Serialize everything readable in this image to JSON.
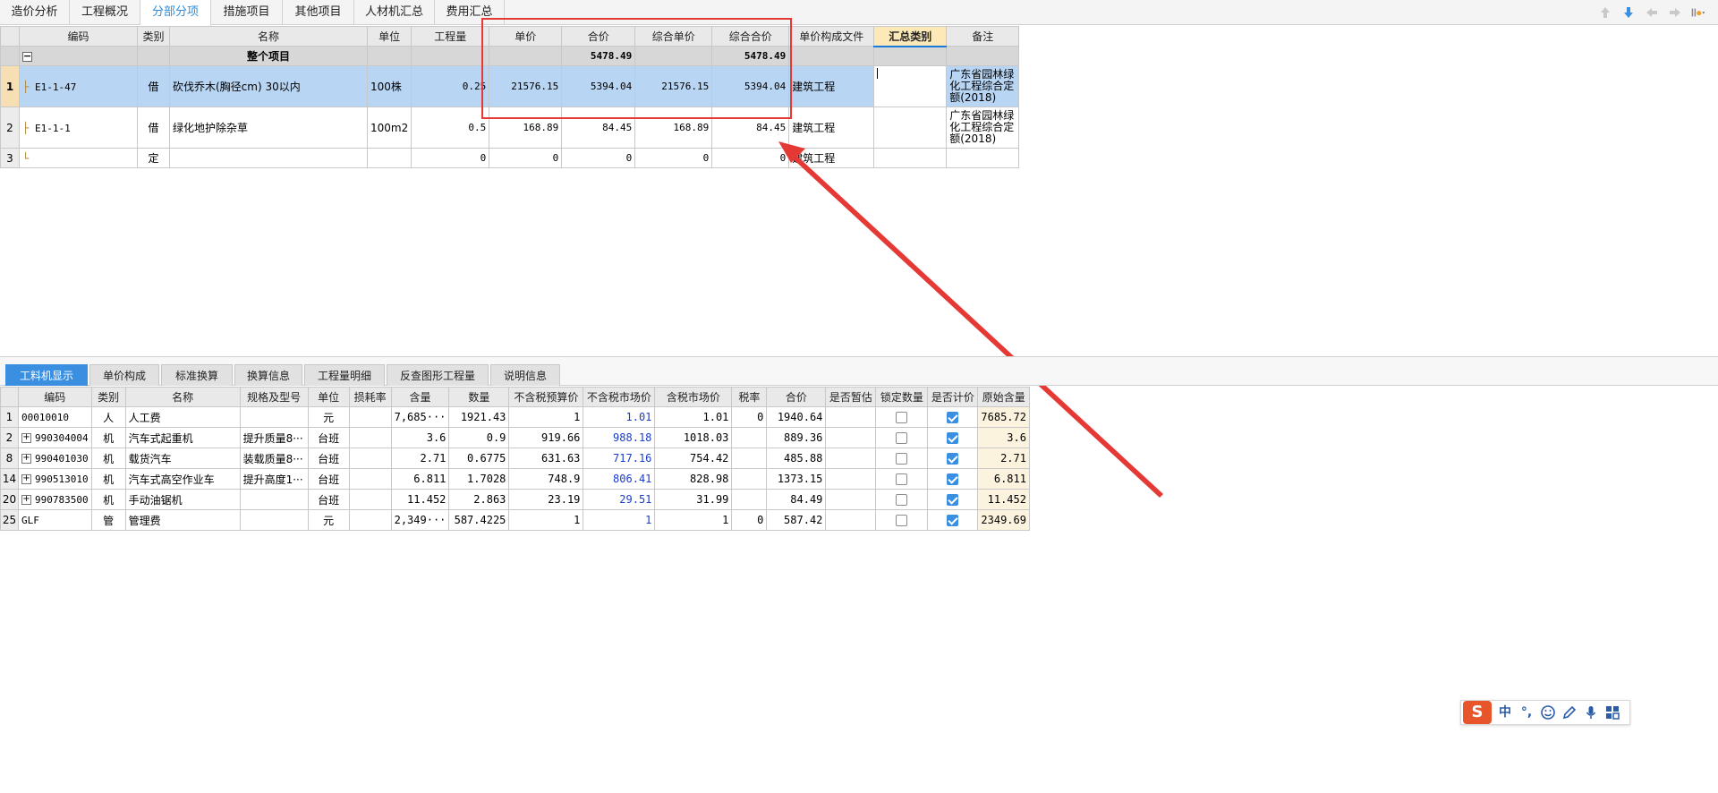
{
  "top_tabs": [
    "造价分析",
    "工程概况",
    "分部分项",
    "措施项目",
    "其他项目",
    "人材机汇总",
    "费用汇总"
  ],
  "top_active_tab": "分部分项",
  "upper_table": {
    "headers": [
      "编码",
      "类别",
      "名称",
      "单位",
      "工程量",
      "单价",
      "合价",
      "综合单价",
      "综合合价",
      "单价构成文件",
      "汇总类别",
      "备注"
    ],
    "summary_row": {
      "name": "整个项目",
      "total_price": "5478.49",
      "comp_total": "5478.49"
    },
    "rows": [
      {
        "num": "1",
        "code": "E1-1-47",
        "type": "借",
        "name": "砍伐乔木(胸径cm) 30以内",
        "unit": "100株",
        "qty": "0.25",
        "unit_price": "21576.15",
        "total_price": "5394.04",
        "comp_unit_price": "21576.15",
        "comp_total": "5394.04",
        "composition_file": "建筑工程",
        "summary_category": "",
        "note": "广东省园林绿化工程综合定额(2018)"
      },
      {
        "num": "2",
        "code": "E1-1-1",
        "type": "借",
        "name": "绿化地护除杂草",
        "unit": "100m2",
        "qty": "0.5",
        "unit_price": "168.89",
        "total_price": "84.45",
        "comp_unit_price": "168.89",
        "comp_total": "84.45",
        "composition_file": "建筑工程",
        "summary_category": "",
        "note": "广东省园林绿化工程综合定额(2018)"
      },
      {
        "num": "3",
        "code": "",
        "type": "定",
        "name": "",
        "unit": "",
        "qty": "0",
        "unit_price": "0",
        "total_price": "0",
        "comp_unit_price": "0",
        "comp_total": "0",
        "composition_file": "建筑工程",
        "summary_category": "",
        "note": ""
      }
    ]
  },
  "lower_tabs": [
    "工料机显示",
    "单价构成",
    "标准换算",
    "换算信息",
    "工程量明细",
    "反查图形工程量",
    "说明信息"
  ],
  "lower_active_tab": "工料机显示",
  "lower_table": {
    "headers": [
      "编码",
      "类别",
      "名称",
      "规格及型号",
      "单位",
      "损耗率",
      "含量",
      "数量",
      "不含税预算价",
      "不含税市场价",
      "含税市场价",
      "税率",
      "合价",
      "是否暂估",
      "锁定数量",
      "是否计价",
      "原始含量"
    ],
    "rows": [
      {
        "num": "1",
        "expand": false,
        "code": "00010010",
        "type": "人",
        "name": "人工费",
        "spec": "",
        "unit": "元",
        "loss": "",
        "content": "7,685···",
        "qty": "1921.43",
        "budget": "1",
        "market": "1.01",
        "market_tax": "1.01",
        "tax": "0",
        "total": "1940.64",
        "locked": false,
        "priced": true,
        "orig": "7685.72"
      },
      {
        "num": "2",
        "expand": true,
        "code": "990304004",
        "type": "机",
        "name": "汽车式起重机",
        "spec": "提升质量8···",
        "unit": "台班",
        "loss": "",
        "content": "3.6",
        "qty": "0.9",
        "budget": "919.66",
        "market": "988.18",
        "market_tax": "1018.03",
        "tax": "",
        "total": "889.36",
        "locked": false,
        "priced": true,
        "orig": "3.6"
      },
      {
        "num": "8",
        "expand": true,
        "code": "990401030",
        "type": "机",
        "name": "载货汽车",
        "spec": "装载质量8···",
        "unit": "台班",
        "loss": "",
        "content": "2.71",
        "qty": "0.6775",
        "budget": "631.63",
        "market": "717.16",
        "market_tax": "754.42",
        "tax": "",
        "total": "485.88",
        "locked": false,
        "priced": true,
        "orig": "2.71"
      },
      {
        "num": "14",
        "expand": true,
        "code": "990513010",
        "type": "机",
        "name": "汽车式高空作业车",
        "spec": "提升高度1···",
        "unit": "台班",
        "loss": "",
        "content": "6.811",
        "qty": "1.7028",
        "budget": "748.9",
        "market": "806.41",
        "market_tax": "828.98",
        "tax": "",
        "total": "1373.15",
        "locked": false,
        "priced": true,
        "orig": "6.811"
      },
      {
        "num": "20",
        "expand": true,
        "code": "990783500",
        "type": "机",
        "name": "手动油锯机",
        "spec": "",
        "unit": "台班",
        "loss": "",
        "content": "11.452",
        "qty": "2.863",
        "budget": "23.19",
        "market": "29.51",
        "market_tax": "31.99",
        "tax": "",
        "total": "84.49",
        "locked": false,
        "priced": true,
        "orig": "11.452"
      },
      {
        "num": "25",
        "expand": false,
        "code": "GLF",
        "type": "管",
        "name": "管理费",
        "spec": "",
        "unit": "元",
        "loss": "",
        "content": "2,349···",
        "qty": "587.4225",
        "budget": "1",
        "market": "1",
        "market_tax": "1",
        "tax": "0",
        "total": "587.42",
        "locked": false,
        "priced": true,
        "orig": "2349.69"
      }
    ]
  },
  "ime": {
    "logo": "S",
    "lang": "中",
    "punct": "°,"
  },
  "colors": {
    "accent": "#3a8fe0",
    "selection": "#b8d5f3",
    "highlight": "#e53935",
    "market_price": "#1b3cc8"
  }
}
